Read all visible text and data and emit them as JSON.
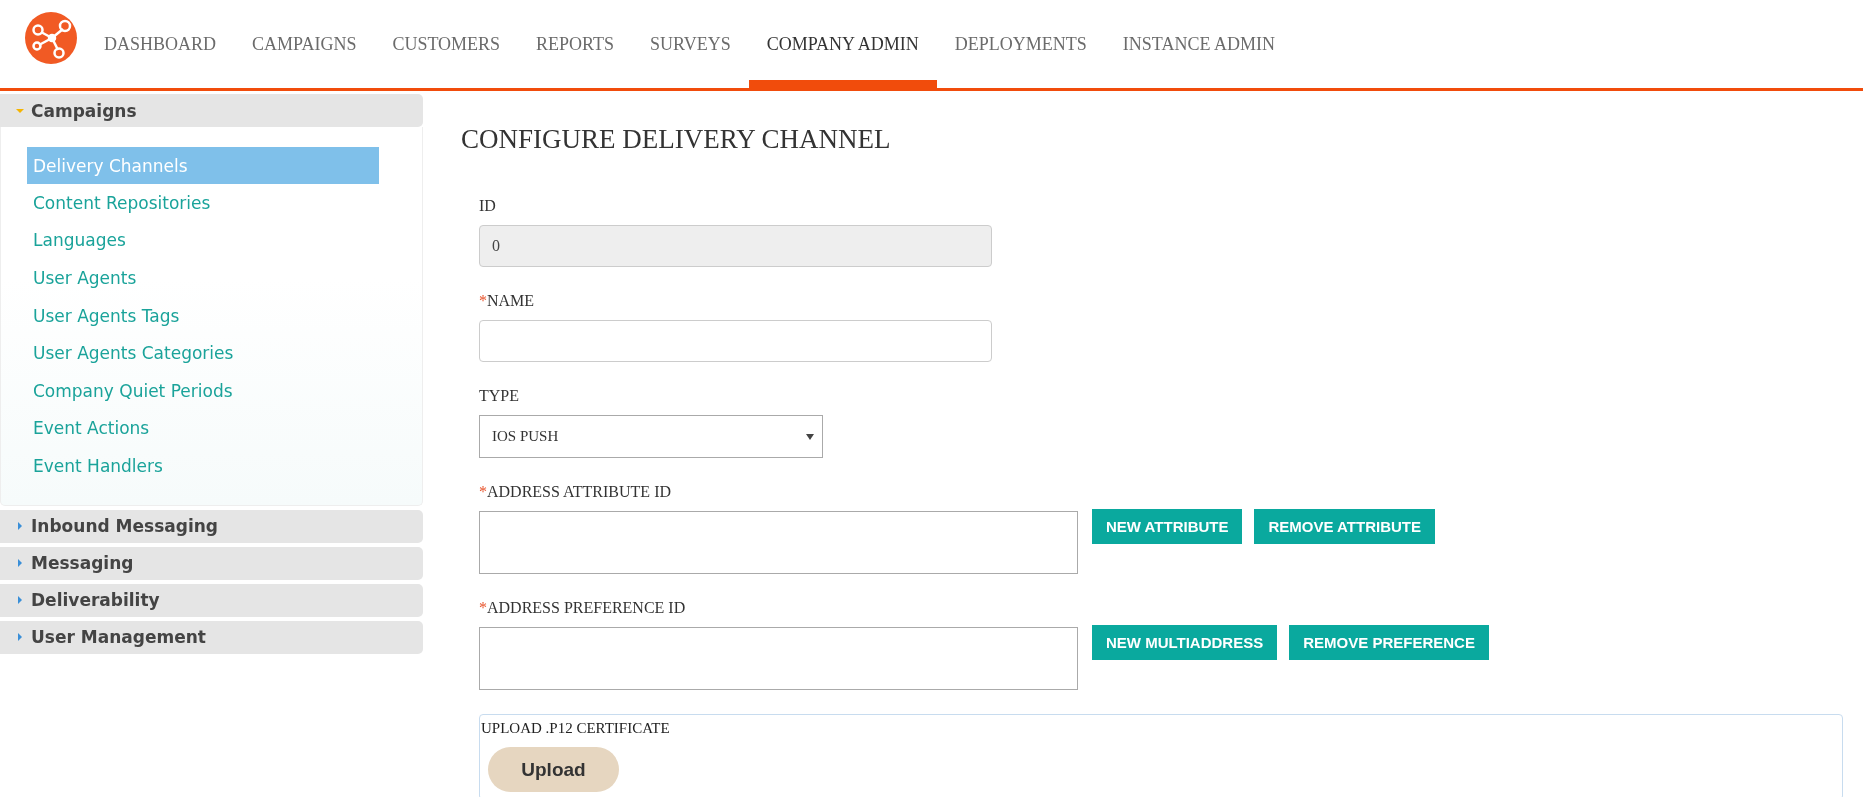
{
  "header": {
    "nav": [
      {
        "label": "DASHBOARD",
        "selected": false
      },
      {
        "label": "CAMPAIGNS",
        "selected": false
      },
      {
        "label": "CUSTOMERS",
        "selected": false
      },
      {
        "label": "REPORTS",
        "selected": false
      },
      {
        "label": "SURVEYS",
        "selected": false
      },
      {
        "label": "COMPANY ADMIN",
        "selected": true
      },
      {
        "label": "DEPLOYMENTS",
        "selected": false
      },
      {
        "label": "INSTANCE ADMIN",
        "selected": false
      }
    ]
  },
  "sidebar": {
    "groups": [
      {
        "title": "Campaigns",
        "expanded": true,
        "items": [
          {
            "label": "Delivery Channels",
            "selected": true
          },
          {
            "label": "Content Repositories",
            "selected": false
          },
          {
            "label": "Languages",
            "selected": false
          },
          {
            "label": "User Agents",
            "selected": false
          },
          {
            "label": "User Agents Tags",
            "selected": false
          },
          {
            "label": "User Agents Categories",
            "selected": false
          },
          {
            "label": "Company Quiet Periods",
            "selected": false
          },
          {
            "label": "Event Actions",
            "selected": false
          },
          {
            "label": "Event Handlers",
            "selected": false
          }
        ]
      },
      {
        "title": "Inbound Messaging",
        "expanded": false
      },
      {
        "title": "Messaging",
        "expanded": false
      },
      {
        "title": "Deliverability",
        "expanded": false
      },
      {
        "title": "User Management",
        "expanded": false
      }
    ]
  },
  "form": {
    "title": "CONFIGURE DELIVERY CHANNEL",
    "fields": [
      {
        "kind": "text",
        "label": "ID",
        "value": "0",
        "disabled": true
      },
      {
        "kind": "text",
        "label": "NAME",
        "marker": "*",
        "disabled": false
      },
      {
        "kind": "select",
        "label": "TYPE",
        "value": "IOS PUSH"
      },
      {
        "kind": "textarea",
        "label": "ADDRESS ATTRIBUTE ID",
        "marker": "*",
        "buttons": [
          "NEW ATTRIBUTE",
          "REMOVE ATTRIBUTE"
        ]
      },
      {
        "kind": "textarea",
        "label": "ADDRESS PREFERENCE ID",
        "marker": "*",
        "buttons": [
          "NEW MULTIADDRESS",
          "REMOVE PREFERENCE"
        ]
      }
    ],
    "upload": {
      "label": "UPLOAD .P12 CERTIFICATE",
      "button": "Upload"
    }
  }
}
